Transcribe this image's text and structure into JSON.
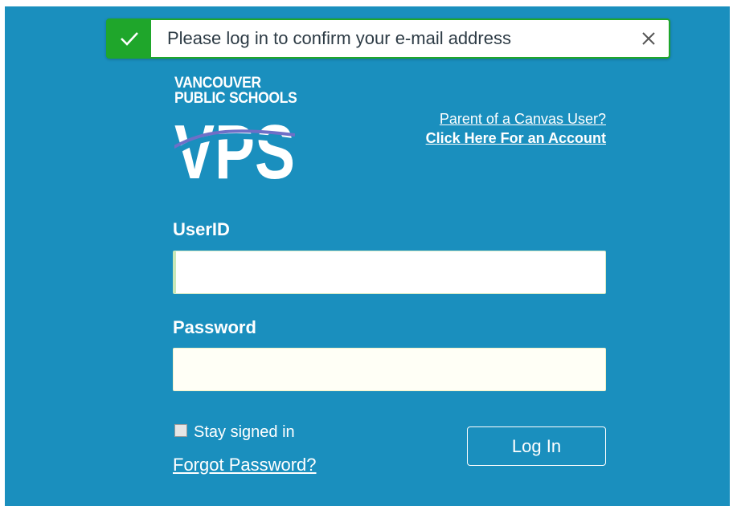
{
  "alert": {
    "message": "Please log in to confirm your e-mail address",
    "icon": "check-icon",
    "close_icon": "close-icon",
    "accent_color": "#1fa62b"
  },
  "logo": {
    "line1": "VANCOUVER",
    "line2": "PUBLIC SCHOOLS",
    "mark": "VPS"
  },
  "parent_links": {
    "line1": "Parent of a Canvas User?",
    "line2": "Click Here For an Account"
  },
  "form": {
    "userid_label": "UserID",
    "userid_value": "",
    "password_label": "Password",
    "password_value": "",
    "stay_signed_in_label": "Stay signed in",
    "stay_signed_in_checked": false,
    "forgot_label": "Forgot Password?",
    "login_label": "Log In"
  },
  "colors": {
    "background": "#1a8fbe",
    "text": "#ffffff"
  }
}
